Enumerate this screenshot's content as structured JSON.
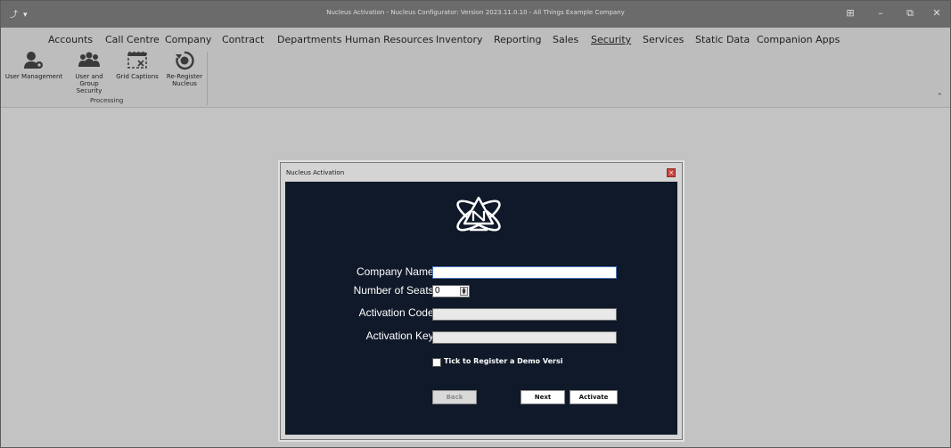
{
  "window": {
    "title": "Nucleus Activation - Nucleus Configurator: Version 2023.11.0.10 - All Things Example Company"
  },
  "ribbon_tabs": [
    {
      "label": "Accounts"
    },
    {
      "label": "Call Centre"
    },
    {
      "label": "Company"
    },
    {
      "label": "Contract"
    },
    {
      "label": "Departments"
    },
    {
      "label": "Human Resources"
    },
    {
      "label": "Inventory"
    },
    {
      "label": "Reporting"
    },
    {
      "label": "Sales"
    },
    {
      "label": "Security",
      "active": true
    },
    {
      "label": "Services"
    },
    {
      "label": "Static Data"
    },
    {
      "label": "Companion Apps"
    }
  ],
  "ribbon": {
    "buttons": [
      {
        "label": "User Management",
        "icon": "user-gear-icon"
      },
      {
        "label": "User and Group Security",
        "icon": "user-group-icon"
      },
      {
        "label": "Grid Captions",
        "icon": "grid-captions-icon"
      },
      {
        "label": "Re-Register Nucleus",
        "icon": "re-register-icon"
      }
    ],
    "group_label": "Processing"
  },
  "dialog": {
    "title": "Nucleus Activation",
    "fields": {
      "company_name_label": "Company Name:",
      "company_name_value": "",
      "seats_label": "Number of Seats:",
      "seats_value": "0",
      "activation_code_label": "Activation Code:",
      "activation_code_value": "",
      "activation_key_label": "Activation Key:",
      "activation_key_value": ""
    },
    "checkbox_label": "Tick to Register a Demo Versi",
    "buttons": {
      "back": "Back",
      "next": "Next",
      "activate": "Activate"
    }
  },
  "colors": {
    "titlebar": "#6b6b6b",
    "ribbon": "#bdbdbd",
    "dialog_body": "#0f1929",
    "close_button": "#c8463e"
  }
}
